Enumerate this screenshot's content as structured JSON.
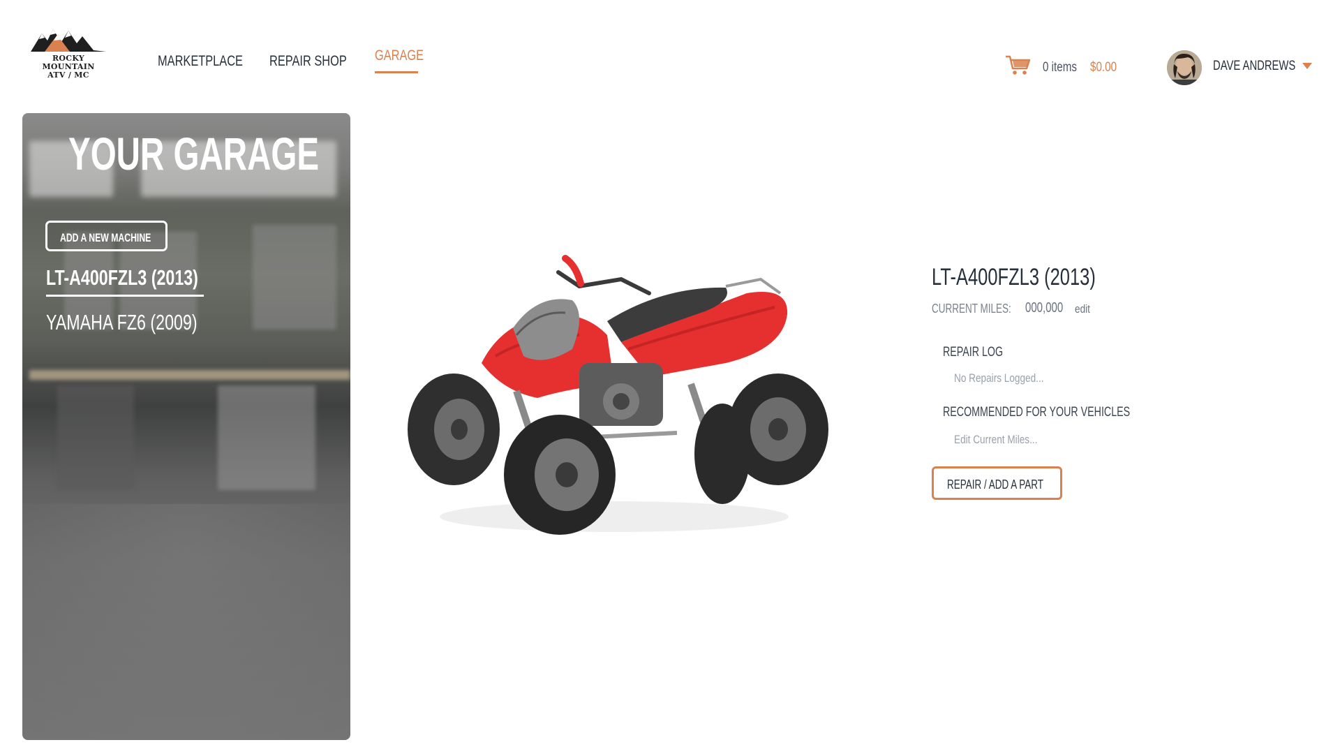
{
  "brand": {
    "line1": "ROCKY MOUNTAIN",
    "line2": "ATV / MC"
  },
  "nav": {
    "items": [
      {
        "label": "MARKETPLACE",
        "active": false
      },
      {
        "label": "REPAIR SHOP",
        "active": false
      },
      {
        "label": "GARAGE",
        "active": true
      }
    ]
  },
  "cart": {
    "icon": "cart-icon",
    "count": "0 items",
    "total": "$0.00"
  },
  "user": {
    "name": "DAVE ANDREWS",
    "icon": "chevron-down-icon"
  },
  "garage": {
    "title": "YOUR GARAGE",
    "add_button": "ADD A NEW MACHINE",
    "machines": [
      {
        "label": "LT-A400FZL3 (2013)",
        "selected": true
      },
      {
        "label": "YAMAHA FZ6 (2009)",
        "selected": false
      }
    ]
  },
  "vehicle": {
    "title": "LT-A400FZL3 (2013)",
    "miles_label": "CURRENT MILES:",
    "miles_value": "000,000",
    "edit_label": "edit",
    "repair_log_title": "REPAIR LOG",
    "repair_log_empty": "No Repairs Logged...",
    "recommended_title": "RECOMMENDED FOR YOUR VEHICLES",
    "recommended_hint": "Edit Current Miles...",
    "repair_button": "REPAIR / ADD A PART"
  },
  "colors": {
    "accent": "#d9814f",
    "text_dark": "#26303a",
    "atv_body": "#e5302f"
  }
}
